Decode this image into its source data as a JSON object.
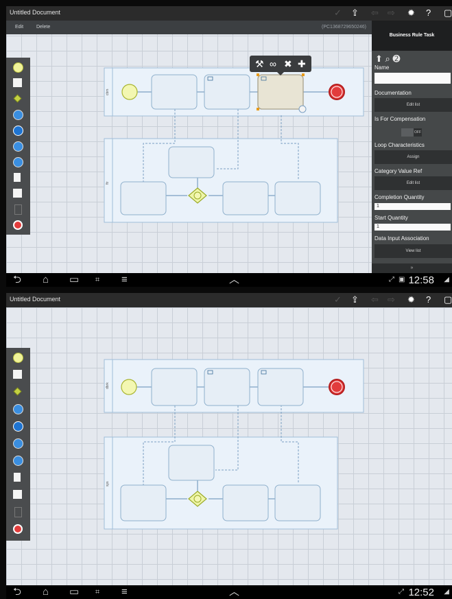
{
  "top_screen": {
    "title": "Untitled Document",
    "editbar": {
      "edit_label": "Edit",
      "delete_label": "Delete",
      "process_id": "(PC1368729650246)"
    },
    "properties": {
      "header": "Business Rule Task",
      "fields": {
        "name_label": "Name",
        "name_value": "",
        "documentation_label": "Documentation",
        "documentation_button": "Edit list",
        "compensation_label": "Is For Compensation",
        "compensation_value": "OFF",
        "loop_label": "Loop Characteristics",
        "loop_button": "Assign",
        "category_label": "Category Value Ref",
        "category_button": "Edit list",
        "completion_label": "Completion Quantity",
        "completion_value": "1",
        "start_label": "Start Quantity",
        "start_value": "1",
        "data_input_label": "Data Input Association",
        "data_input_button": "View list",
        "more_label": "»"
      }
    },
    "lanes": {
      "lane1": "cbm",
      "lane2": "ftr"
    },
    "status": {
      "clock": "12:58"
    }
  },
  "bottom_screen": {
    "title": "Untitled Document",
    "lanes": {
      "lane1": "dbrk",
      "lane2": "sys"
    },
    "status": {
      "clock": "12:52"
    }
  },
  "icons": [
    "check-icon",
    "upload-icon",
    "back-arrow-icon",
    "forward-arrow-icon",
    "gear-icon",
    "help-icon",
    "window-icon",
    "wrench-icon",
    "link-icon",
    "delete-x-icon",
    "plus-icon",
    "arrow-up-icon",
    "search-icon",
    "info-icon"
  ],
  "colors": {
    "task_fill": "#e6eef6",
    "task_stroke": "#8fb0cc",
    "start_event": "#d6e84a",
    "end_event": "#d33333",
    "gateway": "#b7c937",
    "selection": "#e89a1a"
  }
}
